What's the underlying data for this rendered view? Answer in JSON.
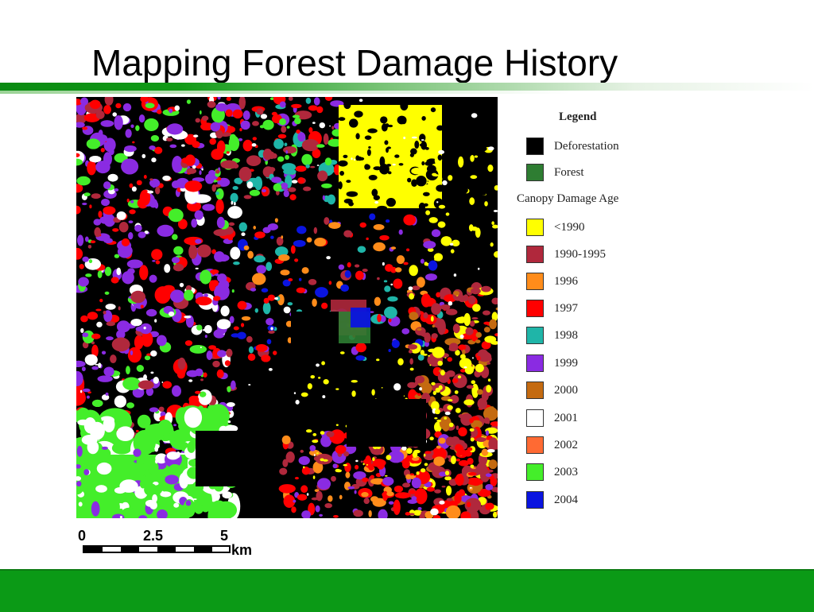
{
  "slide": {
    "title": "Mapping Forest Damage History"
  },
  "legend": {
    "title": "Legend",
    "subheading": "Canopy Damage Age",
    "cover_items": [
      {
        "label": "Deforestation",
        "color": "#000000"
      },
      {
        "label": "Forest",
        "color": "#2e7d32"
      }
    ],
    "age_items": [
      {
        "label": "<1990",
        "color": "#ffff00"
      },
      {
        "label": "1990-1995",
        "color": "#b0283c"
      },
      {
        "label": "1996",
        "color": "#ff8c1a"
      },
      {
        "label": "1997",
        "color": "#ff0000"
      },
      {
        "label": "1998",
        "color": "#1fb5a8"
      },
      {
        "label": "1999",
        "color": "#8a2be2"
      },
      {
        "label": "2000",
        "color": "#c46a10"
      },
      {
        "label": "2001",
        "color": "#ffffff"
      },
      {
        "label": "2002",
        "color": "#ff6a33"
      },
      {
        "label": "2003",
        "color": "#44ee2a"
      },
      {
        "label": "2004",
        "color": "#0a14e0"
      }
    ]
  },
  "scale": {
    "ticks": [
      "0",
      "2.5",
      "5"
    ],
    "unit": "km"
  },
  "colors": {
    "accent_green": "#0b9a16"
  }
}
